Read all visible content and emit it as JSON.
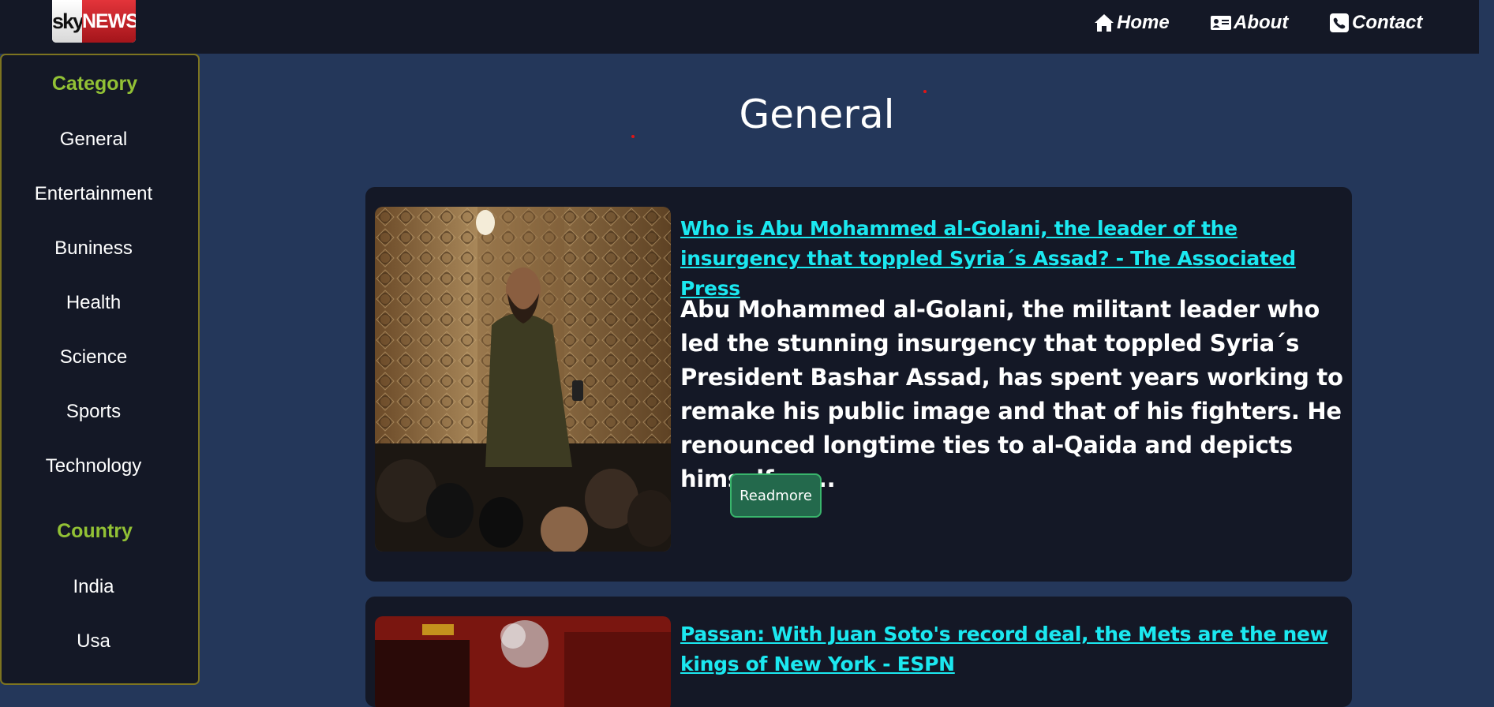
{
  "brand": {
    "logo_left": "sky",
    "logo_right": "NEWS",
    "red": "#d42a30"
  },
  "nav": {
    "home": {
      "icon": "home-icon",
      "label": "Home"
    },
    "about": {
      "icon": "id-card-icon",
      "label": "About"
    },
    "contact": {
      "icon": "phone-icon",
      "label": "Contact"
    }
  },
  "sidebar": {
    "category_heading": "Category",
    "categories": [
      "General",
      "Entertainment",
      "Buniness",
      "Health",
      "Science",
      "Sports",
      "Technology"
    ],
    "country_heading": "Country",
    "countries": [
      "India",
      "Usa"
    ]
  },
  "page": {
    "title": "General"
  },
  "articles": [
    {
      "title": "Who is Abu Mohammed al-Golani, the leader of the insurgency that toppled Syria´s Assad? - The Associated Press",
      "description": "Abu Mohammed al-Golani, the militant leader who led the stunning insurgency that toppled Syria´s President Bashar Assad, has spent years working to remake his public image and that of his fighters. He renounced longtime ties to al-Qaida and depicts himself as...",
      "button": "Readmore"
    },
    {
      "title": "Passan: With Juan Soto's record deal, the Mets are the new kings of New York - ESPN"
    }
  ],
  "colors": {
    "background": "#24375a",
    "panel": "#141826",
    "accent_green": "#92c135",
    "link_cyan": "#1be8f0",
    "button_green": "#23694c"
  }
}
